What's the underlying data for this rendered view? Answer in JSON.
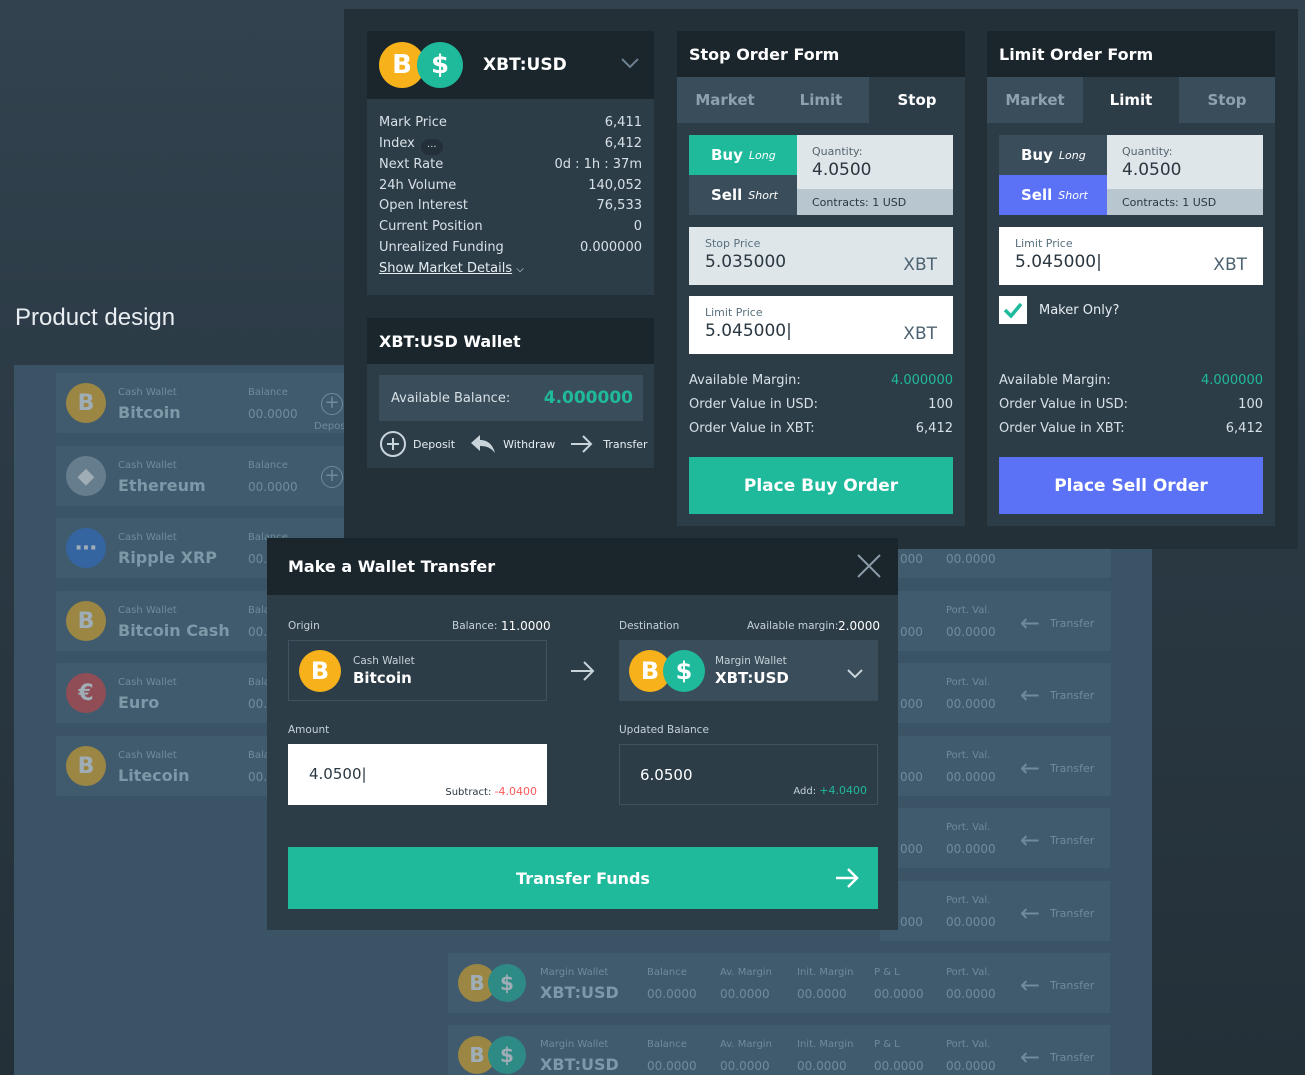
{
  "product_label": "Product design",
  "background": {
    "cash_rows": [
      {
        "coin": "B",
        "coin_color": "#f7b21b",
        "label": "Cash Wallet",
        "name": "Bitcoin",
        "bal_label": "Balance",
        "balance": "00.0000"
      },
      {
        "coin": "◆",
        "coin_color": "#8ea0ad",
        "label": "Cash Wallet",
        "name": "Ethereum",
        "bal_label": "Balance",
        "balance": "00.0000"
      },
      {
        "coin": "⋯",
        "coin_color": "#2d6fd6",
        "label": "Cash Wallet",
        "name": "Ripple XRP",
        "bal_label": "Balance",
        "balance": "00.0"
      },
      {
        "coin": "B",
        "coin_color": "#f7b21b",
        "label": "Cash Wallet",
        "name": "Bitcoin Cash",
        "bal_label": "Bala",
        "balance": "00.0"
      },
      {
        "coin": "€",
        "coin_color": "#e04040",
        "label": "Cash Wallet",
        "name": "Euro",
        "bal_label": "Bala",
        "balance": "00.0"
      },
      {
        "coin": "B",
        "coin_color": "#f7b21b",
        "label": "Cash Wallet",
        "name": "Litecoin",
        "bal_label": "Bala",
        "balance": "00.0"
      }
    ],
    "deposit_partial": "Depos",
    "margin_rows": [
      {
        "label": "Margin Wallet",
        "name": "XBT:USD",
        "cols": [
          {
            "h": "Balance",
            "v": "00.0000"
          },
          {
            "h": "Av. Margin",
            "v": "00.0000"
          },
          {
            "h": "Init. Margin",
            "v": "00.0000"
          },
          {
            "h": "P & L",
            "v": "00.0000"
          },
          {
            "h": "Port. Val.",
            "v": "00.0000"
          }
        ],
        "transfer": "Transfer"
      },
      {
        "label": "Margin Wallet",
        "name": "XBT:USD",
        "cols": [
          {
            "h": "Balance",
            "v": "00.0000"
          },
          {
            "h": "Av. Margin",
            "v": "00.0000"
          },
          {
            "h": "Init. Margin",
            "v": "00.0000"
          },
          {
            "h": "P & L",
            "v": "00.0000"
          },
          {
            "h": "Port. Val.",
            "v": "00.0000"
          }
        ],
        "transfer": "Transfer"
      }
    ],
    "right_rows": [
      {
        "a": "000",
        "h": "",
        "v": "00.0000",
        "transfer": ""
      },
      {
        "a": "000",
        "h": "Port. Val.",
        "v": "00.0000",
        "transfer": "Transfer"
      },
      {
        "a": "000",
        "h": "Port. Val.",
        "v": "00.0000",
        "transfer": "Transfer"
      },
      {
        "a": "000",
        "h": "Port. Val.",
        "v": "00.0000",
        "transfer": "Transfer"
      },
      {
        "a": "000",
        "h": "Port. Val.",
        "v": "00.0000",
        "transfer": "Transfer"
      },
      {
        "a": "000",
        "h": "Port. Val.",
        "v": "00.0000",
        "transfer": "Transfer"
      }
    ]
  },
  "market": {
    "symbol": "XBT:USD",
    "rows": [
      {
        "k": "Mark Price",
        "v": "6,411"
      },
      {
        "k": "Index",
        "v": "6,412"
      },
      {
        "k": "Next Rate",
        "v": "0d : 1h : 37m"
      },
      {
        "k": "24h Volume",
        "v": "140,052"
      },
      {
        "k": "Open Interest",
        "v": "76,533"
      },
      {
        "k": "Current Position",
        "v": "0"
      },
      {
        "k": "Unrealized Funding",
        "v": "0.000000"
      }
    ],
    "index_more": "...",
    "details_link": "Show Market Details"
  },
  "wallet": {
    "title": "XBT:USD Wallet",
    "avail_label": "Available Balance:",
    "avail_value": "4.000000",
    "deposit": "Deposit",
    "withdraw": "Withdraw",
    "transfer": "Transfer"
  },
  "stop_form": {
    "title": "Stop Order Form",
    "tabs": [
      "Market",
      "Limit",
      "Stop"
    ],
    "buy": "Buy",
    "buy_sub": "Long",
    "sell": "Sell",
    "sell_sub": "Short",
    "qty_label": "Quantity:",
    "qty": "4.0500",
    "contracts": "Contracts: 1 USD",
    "stop_label": "Stop Price",
    "stop_value": "5.035000",
    "stop_unit": "XBT",
    "limit_label": "Limit Price",
    "limit_value": "5.045000|",
    "limit_unit": "XBT",
    "summary": [
      {
        "k": "Available Margin:",
        "v": "4.000000"
      },
      {
        "k": "Order Value in USD:",
        "v": "100"
      },
      {
        "k": "Order Value in XBT:",
        "v": "6,412"
      }
    ],
    "button": "Place Buy Order"
  },
  "limit_form": {
    "title": "Limit Order Form",
    "tabs": [
      "Market",
      "Limit",
      "Stop"
    ],
    "buy": "Buy",
    "buy_sub": "Long",
    "sell": "Sell",
    "sell_sub": "Short",
    "qty_label": "Quantity:",
    "qty": "4.0500",
    "contracts": "Contracts: 1 USD",
    "limit_label": "Limit Price",
    "limit_value": "5.045000|",
    "limit_unit": "XBT",
    "maker": "Maker Only?",
    "summary": [
      {
        "k": "Available Margin:",
        "v": "4.000000"
      },
      {
        "k": "Order Value in USD:",
        "v": "100"
      },
      {
        "k": "Order Value in XBT:",
        "v": "6,412"
      }
    ],
    "button": "Place Sell Order"
  },
  "transfer": {
    "title": "Make a Wallet Transfer",
    "origin_label": "Origin",
    "origin_bal_label": "Balance:",
    "origin_bal": "11.0000",
    "origin_sub": "Cash Wallet",
    "origin_name": "Bitcoin",
    "dest_label": "Destination",
    "dest_margin_label": "Available margin:",
    "dest_margin": "2.0000",
    "dest_sub": "Margin Wallet",
    "dest_name": "XBT:USD",
    "amount_label": "Amount",
    "amount": "4.0500|",
    "subtract_label": "Subtract:",
    "subtract": "-4.0400",
    "updated_label": "Updated Balance",
    "updated": "6.0500",
    "add_label": "Add:",
    "add": "+4.0400",
    "button": "Transfer Funds"
  },
  "colors": {
    "teal": "#1fb99b",
    "blue": "#5b72f6",
    "btc": "#f7b21b",
    "negative": "#ff5a5a"
  }
}
